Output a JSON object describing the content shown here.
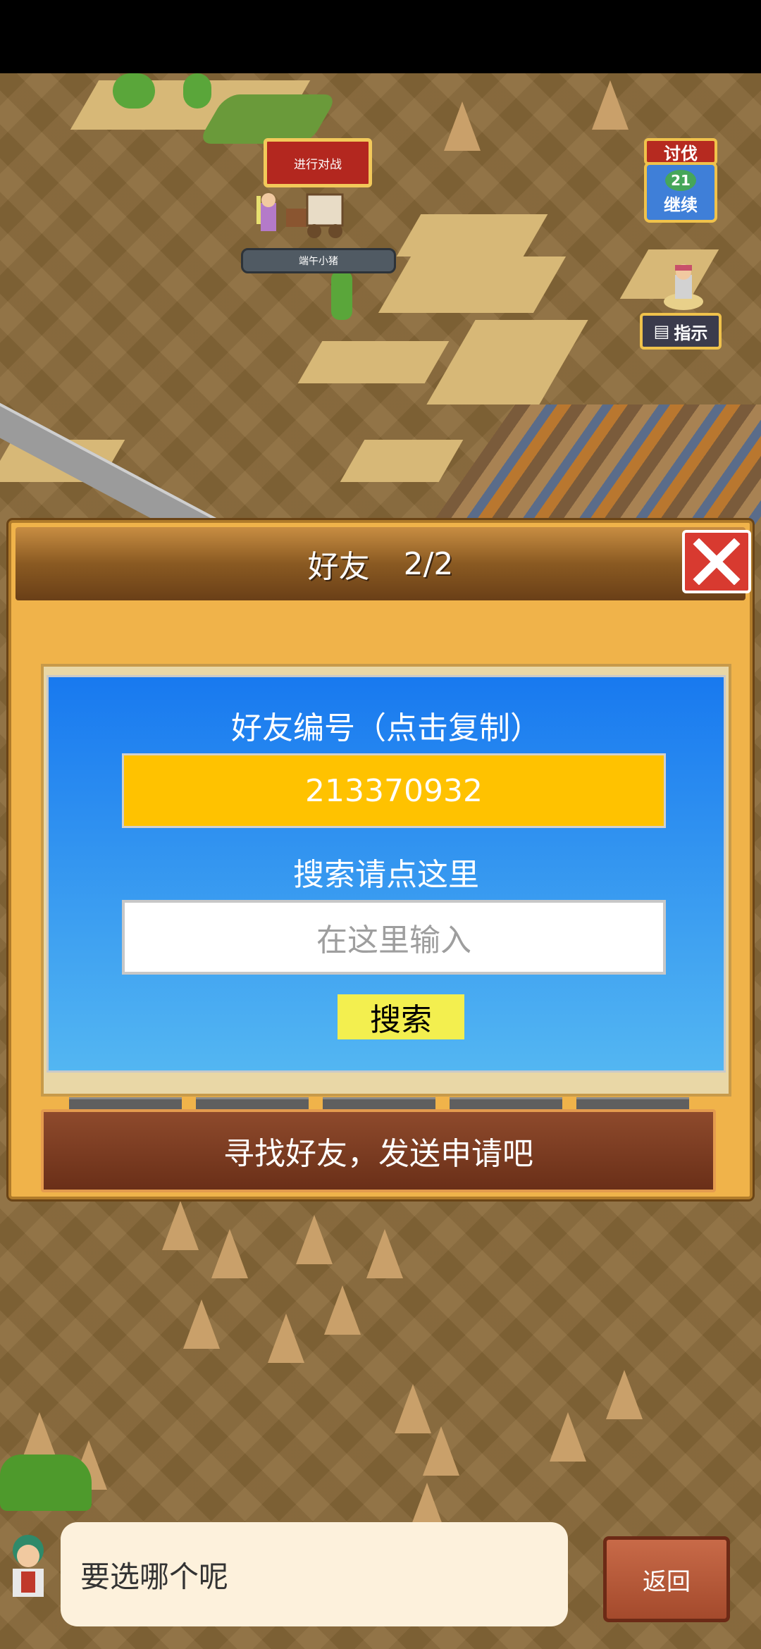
{
  "map": {
    "battle_button": "进行对战",
    "player_name": "端午小猪",
    "quest": {
      "title": "讨伐",
      "level": "21",
      "action": "继续"
    },
    "hint_button": "指示"
  },
  "dialog": {
    "title": "好友",
    "page": "2/2",
    "friend_id_label": "好友编号（点击复制）",
    "friend_id": "213370932",
    "search_label": "搜索请点这里",
    "search_placeholder": "在这里输入",
    "search_button": "搜索",
    "banner": "寻找好友，发送申请吧"
  },
  "bottom": {
    "message": "要选哪个呢",
    "back_button": "返回"
  },
  "colors": {
    "dialog_bg": "#f0b34a",
    "panel_blue": "#1879ef",
    "id_box": "#ffc200",
    "close_red": "#d83a30",
    "search_button": "#f3ef4f"
  }
}
